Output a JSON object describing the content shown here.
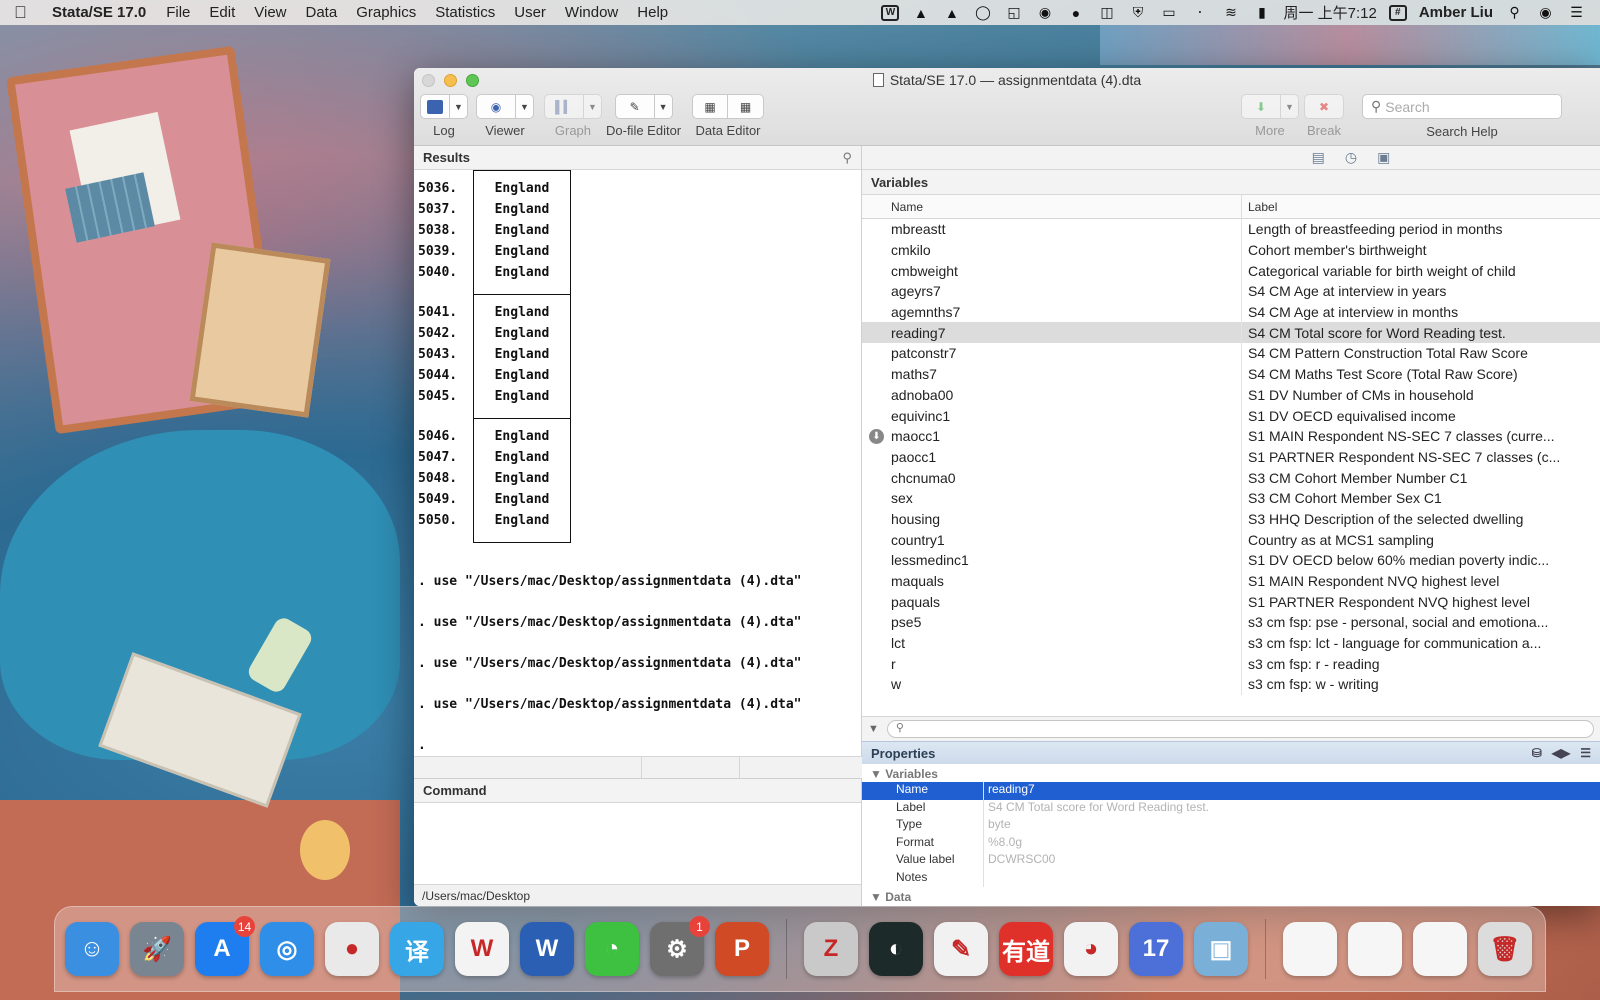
{
  "menubar": {
    "app_name": "Stata/SE 17.0",
    "menus": [
      "File",
      "Edit",
      "View",
      "Data",
      "Graphics",
      "Statistics",
      "User",
      "Window",
      "Help"
    ],
    "clock": "周一 上午7:12",
    "user": "Amber Liu"
  },
  "window": {
    "title": "Stata/SE 17.0 — assignmentdata (4).dta",
    "toolbar": {
      "log": "Log",
      "viewer": "Viewer",
      "graph": "Graph",
      "dofile": "Do-file Editor",
      "dataeditor": "Data Editor",
      "more": "More",
      "break": "Break",
      "search_placeholder": "Search",
      "search_help": "Search Help"
    }
  },
  "results": {
    "header": "Results",
    "blocks": [
      [
        [
          "5036.",
          "England"
        ],
        [
          "5037.",
          "England"
        ],
        [
          "5038.",
          "England"
        ],
        [
          "5039.",
          "England"
        ],
        [
          "5040.",
          "England"
        ]
      ],
      [
        [
          "5041.",
          "England"
        ],
        [
          "5042.",
          "England"
        ],
        [
          "5043.",
          "England"
        ],
        [
          "5044.",
          "England"
        ],
        [
          "5045.",
          "England"
        ]
      ],
      [
        [
          "5046.",
          "England"
        ],
        [
          "5047.",
          "England"
        ],
        [
          "5048.",
          "England"
        ],
        [
          "5049.",
          "England"
        ],
        [
          "5050.",
          "England"
        ]
      ]
    ],
    "commands": [
      ". use \"/Users/mac/Desktop/assignmentdata (4).dta\"",
      ". use \"/Users/mac/Desktop/assignmentdata (4).dta\"",
      ". use \"/Users/mac/Desktop/assignmentdata (4).dta\"",
      ". use \"/Users/mac/Desktop/assignmentdata (4).dta\""
    ],
    "prompt": "."
  },
  "command": {
    "header": "Command",
    "cwd": "/Users/mac/Desktop"
  },
  "variables": {
    "title": "Variables",
    "col_name": "Name",
    "col_label": "Label",
    "selected_index": 5,
    "rows": [
      {
        "name": "mbreastt",
        "label": "Length of breastfeeding period in months"
      },
      {
        "name": "cmkilo",
        "label": "Cohort member's birthweight"
      },
      {
        "name": "cmbweight",
        "label": "Categorical variable for birth weight of child"
      },
      {
        "name": "ageyrs7",
        "label": "S4 CM Age at interview in years"
      },
      {
        "name": "agemnths7",
        "label": "S4 CM Age at interview in months"
      },
      {
        "name": "reading7",
        "label": "S4 CM Total score for Word Reading test."
      },
      {
        "name": "patconstr7",
        "label": "S4 CM Pattern Construction Total Raw Score"
      },
      {
        "name": "maths7",
        "label": "S4 CM Maths Test Score (Total Raw Score)"
      },
      {
        "name": "adnoba00",
        "label": "S1 DV Number of CMs in household"
      },
      {
        "name": "equivinc1",
        "label": "S1 DV  OECD equivalised income"
      },
      {
        "name": "maocc1",
        "label": "S1 MAIN Respondent NS-SEC 7 classes (curre..."
      },
      {
        "name": "paocc1",
        "label": "S1 PARTNER Respondent NS-SEC 7 classes (c..."
      },
      {
        "name": "chcnuma0",
        "label": "S3 CM Cohort Member Number C1"
      },
      {
        "name": "sex",
        "label": "S3 CM Cohort Member Sex C1"
      },
      {
        "name": "housing",
        "label": "S3 HHQ Description of the selected dwelling"
      },
      {
        "name": "country1",
        "label": "Country as at MCS1 sampling"
      },
      {
        "name": "lessmedinc1",
        "label": "S1 DV  OECD below 60% median poverty indic..."
      },
      {
        "name": "maquals",
        "label": "S1 MAIN Respondent NVQ highest level"
      },
      {
        "name": "paquals",
        "label": "S1 PARTNER Respondent NVQ highest level"
      },
      {
        "name": "pse5",
        "label": "s3 cm fsp: pse - personal, social and emotiona..."
      },
      {
        "name": "lct",
        "label": "s3 cm fsp: lct - language for communication a..."
      },
      {
        "name": "r",
        "label": "s3 cm fsp: r - reading"
      },
      {
        "name": "w",
        "label": "s3 cm fsp: w - writing"
      }
    ]
  },
  "properties": {
    "title": "Properties",
    "group_variables": "Variables",
    "group_data": "Data",
    "rows": [
      {
        "key": "Name",
        "value": "reading7"
      },
      {
        "key": "Label",
        "value": "S4 CM Total score for Word Reading test."
      },
      {
        "key": "Type",
        "value": "byte"
      },
      {
        "key": "Format",
        "value": "%8.0g"
      },
      {
        "key": "Value label",
        "value": "DCWRSC00"
      },
      {
        "key": "Notes",
        "value": ""
      }
    ]
  },
  "dock": {
    "app_store_badge": "14",
    "settings_badge": "1",
    "apps": [
      {
        "icon": "finder-icon",
        "glyph": "☺",
        "color": "#3a8fe0"
      },
      {
        "icon": "launchpad-icon",
        "glyph": "🚀",
        "color": "#7a8592"
      },
      {
        "icon": "app-store-icon",
        "glyph": "A",
        "color": "#1e7ef0"
      },
      {
        "icon": "safari-icon",
        "glyph": "◎",
        "color": "#2f8ee8"
      },
      {
        "icon": "chrome-icon",
        "glyph": "●",
        "color": "#e9e9e9"
      },
      {
        "icon": "translate-icon",
        "glyph": "译",
        "color": "#36a6e6"
      },
      {
        "icon": "wps-icon",
        "glyph": "W",
        "color": "#f3f3f3"
      },
      {
        "icon": "word-icon",
        "glyph": "W",
        "color": "#2b5fb4"
      },
      {
        "icon": "wechat-icon",
        "glyph": "◔",
        "color": "#3ec041"
      },
      {
        "icon": "system-preferences-icon",
        "glyph": "⚙",
        "color": "#6f6f6f"
      },
      {
        "icon": "powerpoint-icon",
        "glyph": "P",
        "color": "#d04a26"
      },
      {
        "icon": "zotero-icon",
        "glyph": "Z",
        "color": "#c9c9c9"
      },
      {
        "icon": "pangolin-icon",
        "glyph": "◐",
        "color": "#1c2a2a"
      },
      {
        "icon": "notes-icon",
        "glyph": "✎",
        "color": "#f1f1f1"
      },
      {
        "icon": "youdao-icon",
        "glyph": "有道",
        "color": "#e0302a"
      },
      {
        "icon": "qq-icon",
        "glyph": "◕",
        "color": "#f2f2f2"
      },
      {
        "icon": "stata-icon",
        "glyph": "17",
        "color": "#4d6fd8"
      },
      {
        "icon": "preview-icon",
        "glyph": "▣",
        "color": "#7ab0d8"
      },
      {
        "icon": "document-thumb-1",
        "glyph": "",
        "color": "#f6f6f6"
      },
      {
        "icon": "document-thumb-2",
        "glyph": "",
        "color": "#f6f6f6"
      },
      {
        "icon": "document-thumb-3",
        "glyph": "",
        "color": "#f6f6f6"
      },
      {
        "icon": "trash-icon",
        "glyph": "🗑",
        "color": "#dcdcdc"
      }
    ]
  }
}
